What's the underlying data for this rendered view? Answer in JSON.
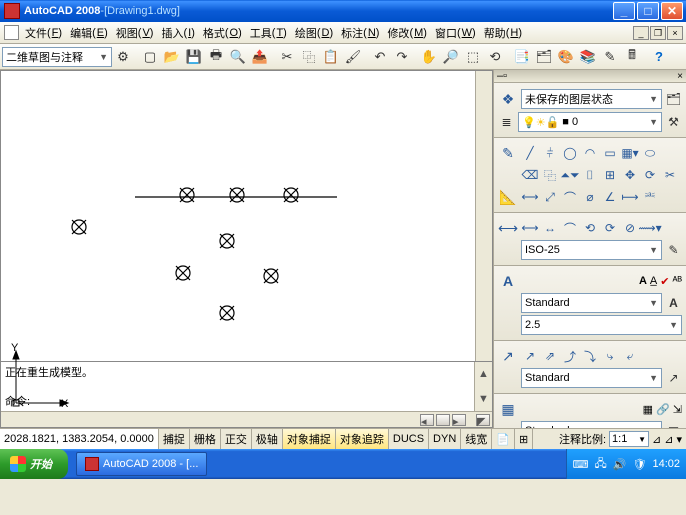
{
  "title": {
    "app": "AutoCAD 2008",
    "sep": " - ",
    "doc": "[Drawing1.dwg]"
  },
  "menu": {
    "items": [
      {
        "label": "文件",
        "key": "F"
      },
      {
        "label": "编辑",
        "key": "E"
      },
      {
        "label": "视图",
        "key": "V"
      },
      {
        "label": "插入",
        "key": "I"
      },
      {
        "label": "格式",
        "key": "O"
      },
      {
        "label": "工具",
        "key": "T"
      },
      {
        "label": "绘图",
        "key": "D"
      },
      {
        "label": "标注",
        "key": "N"
      },
      {
        "label": "修改",
        "key": "M"
      },
      {
        "label": "窗口",
        "key": "W"
      },
      {
        "label": "帮助",
        "key": "H"
      }
    ]
  },
  "workspace": {
    "value": "二维草图与注释"
  },
  "layer": {
    "state": "未保存的图层状态",
    "current": "0"
  },
  "dimstyle": {
    "value": "ISO-25"
  },
  "textstyle": {
    "value": "Standard",
    "height": "2.5"
  },
  "tablestyle": {
    "value": "Standard"
  },
  "mleader": {
    "value": "Standard"
  },
  "cmd": {
    "line1": "正在重生成模型。",
    "prompt": "命令:"
  },
  "status": {
    "coords": "2028.1821, 1383.2054, 0.0000",
    "buttons": [
      "捕捉",
      "栅格",
      "正交",
      "极轴",
      "对象捕捉",
      "对象追踪",
      "DUCS",
      "DYN",
      "线宽"
    ],
    "on_idx": [
      4,
      5
    ],
    "annoscale_label": "注释比例:",
    "annoscale": "1:1"
  },
  "taskbar": {
    "start": "开始",
    "task": "AutoCAD 2008 - [...",
    "time": "14:02"
  }
}
